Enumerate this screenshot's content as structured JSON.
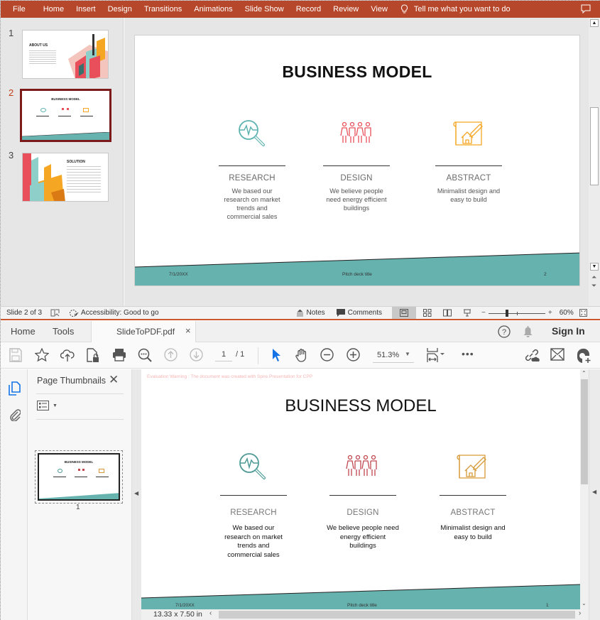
{
  "powerpoint": {
    "menu": [
      "File",
      "Home",
      "Insert",
      "Design",
      "Transitions",
      "Animations",
      "Slide Show",
      "Record",
      "Review",
      "View"
    ],
    "tell_me": "Tell me what you want to do",
    "thumbnails": [
      {
        "num": "1",
        "title": "ABOUT US"
      },
      {
        "num": "2",
        "title": "BUSINESS MODEL"
      },
      {
        "num": "3",
        "title": "SOLUTION"
      }
    ],
    "selected_slide": 2,
    "slide": {
      "title": "BUSINESS MODEL",
      "columns": [
        {
          "icon": "research-magnifier-icon",
          "heading": "RESEARCH",
          "text": "We based our research on market trends and commercial sales",
          "color": "#5fb3b0"
        },
        {
          "icon": "people-group-icon",
          "heading": "DESIGN",
          "text": "We believe people need energy efficient buildings",
          "color": "#e8505b"
        },
        {
          "icon": "house-blueprint-icon",
          "heading": "ABSTRACT",
          "text": "Minimalist design and easy to build",
          "color": "#f5a623"
        }
      ],
      "footer_date": "7/1/20XX",
      "footer_title": "Pitch deck title",
      "footer_page": "2",
      "band_color": "#66b2ae"
    },
    "status": {
      "slide_info": "Slide 2 of 3",
      "accessibility": "Accessibility: Good to go",
      "notes": "Notes",
      "comments": "Comments",
      "zoom": "60%"
    },
    "theme_color": "#b7472a"
  },
  "acrobat": {
    "tabs": {
      "home": "Home",
      "tools": "Tools",
      "file": "SlideToPDF.pdf"
    },
    "sign_in": "Sign In",
    "page_current": "1",
    "page_total": "/ 1",
    "zoom": "51.3%",
    "panel_title": "Page Thumbnails",
    "thumb_label": "1",
    "page_size": "13.33 x 7.50 in",
    "doc": {
      "watermark": "Evaluation Warning : The document was created with  Spire.Presentation for CPP",
      "title": "BUSINESS MODEL",
      "columns": [
        {
          "heading": "RESEARCH",
          "text": "We based our research on market trends and commercial sales",
          "color": "#4f9a96"
        },
        {
          "heading": "DESIGN",
          "text": "We believe people need energy efficient buildings",
          "color": "#c0464f"
        },
        {
          "heading": "ABSTRACT",
          "text": "Minimalist design and easy to build",
          "color": "#d59a38"
        }
      ],
      "footer_date": "7/1/20XX",
      "footer_title": "Pitch deck title",
      "footer_page": "1"
    }
  }
}
